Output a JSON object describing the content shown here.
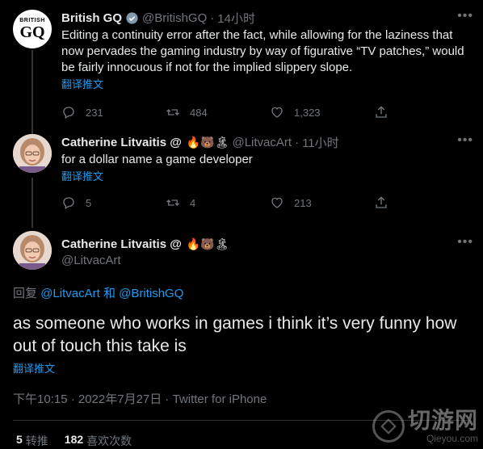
{
  "tweets": [
    {
      "name": "British GQ",
      "handle": "@BritishGQ",
      "time": "14小时",
      "text": "Editing a continuity error after the fact, while allowing for the laziness that now pervades the gaming industry by way of figurative “TV patches,” would be fairly innocuous if not for the implied slippery slope.",
      "translate": "翻译推文",
      "replies": "231",
      "retweets": "484",
      "likes": "1,323",
      "avatar_text_top": "BRITISH",
      "avatar_text_bottom": "GQ",
      "more_icon": "more-icon"
    },
    {
      "name": "Catherine Litvaitis @",
      "emojis": "🔥🐻🏝",
      "handle": "@LitvacArt",
      "time": "11小时",
      "text": "for a dollar name a game developer",
      "translate": "翻译推文",
      "replies": "5",
      "retweets": "4",
      "likes": "213"
    }
  ],
  "main": {
    "name": "Catherine Litvaitis @",
    "emojis": "🔥🐻🏝",
    "handle": "@LitvacArt",
    "reply_prefix": "回复",
    "reply_to_1": "@LitvacArt",
    "reply_and": "和",
    "reply_to_2": "@BritishGQ",
    "text": "as someone who works in games i think it’s very funny how out of touch this take is",
    "translate": "翻译推文",
    "timestamp": "下午10:15 · 2022年7月27日 · Twitter for iPhone",
    "retweet_count": "5",
    "retweet_label": "转推",
    "like_count": "182",
    "like_label": "喜欢次数"
  },
  "watermark": {
    "text": "切游网",
    "sub": "Qieyou.com"
  },
  "colors": {
    "background": "#000000",
    "accent": "#1d9bf0",
    "muted": "#71767b"
  }
}
